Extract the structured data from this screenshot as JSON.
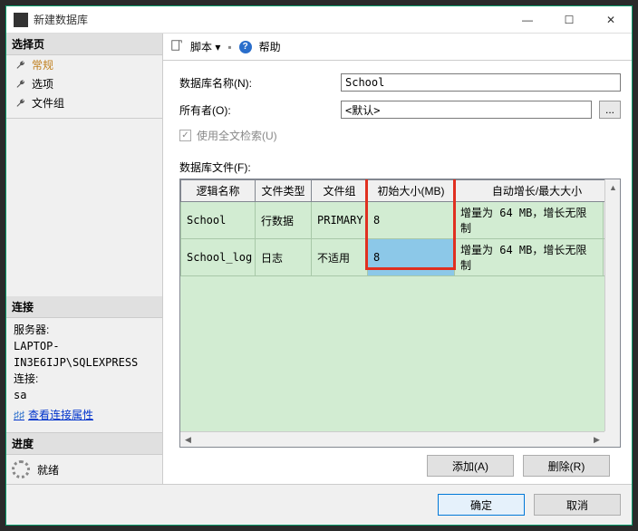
{
  "window": {
    "title": "新建数据库",
    "minimize": "—",
    "maximize": "☐",
    "close": "✕"
  },
  "sidebar": {
    "select_page_header": "选择页",
    "pages": [
      {
        "label": "常规"
      },
      {
        "label": "选项"
      },
      {
        "label": "文件组"
      }
    ],
    "connection_header": "连接",
    "server_label": "服务器:",
    "server_value": "LAPTOP-IN3E6IJP\\SQLEXPRESS",
    "conn_label": "连接:",
    "conn_value": "sa",
    "view_props": "查看连接属性",
    "progress_header": "进度",
    "progress_status": "就绪"
  },
  "toolbar": {
    "script": "脚本",
    "help": "帮助"
  },
  "form": {
    "dbname_label": "数据库名称(N):",
    "dbname_value": "School",
    "owner_label": "所有者(O):",
    "owner_value": "<默认>",
    "owner_browse": "...",
    "fulltext_label": "使用全文检索(U)",
    "files_label": "数据库文件(F):"
  },
  "grid": {
    "headers": {
      "logical_name": "逻辑名称",
      "file_type": "文件类型",
      "filegroup": "文件组",
      "initial_size": "初始大小(MB)",
      "autogrowth": "自动增长/最大大小"
    },
    "rows": [
      {
        "logical_name": "School",
        "file_type": "行数据",
        "filegroup": "PRIMARY",
        "initial_size": "8",
        "autogrowth": "增量为 64 MB，增长无限制"
      },
      {
        "logical_name": "School_log",
        "file_type": "日志",
        "filegroup": "不适用",
        "initial_size": "8",
        "autogrowth": "增量为 64 MB，增长无限制"
      }
    ]
  },
  "actions": {
    "add": "添加(A)",
    "remove": "删除(R)"
  },
  "footer": {
    "ok": "确定",
    "cancel": "取消"
  }
}
